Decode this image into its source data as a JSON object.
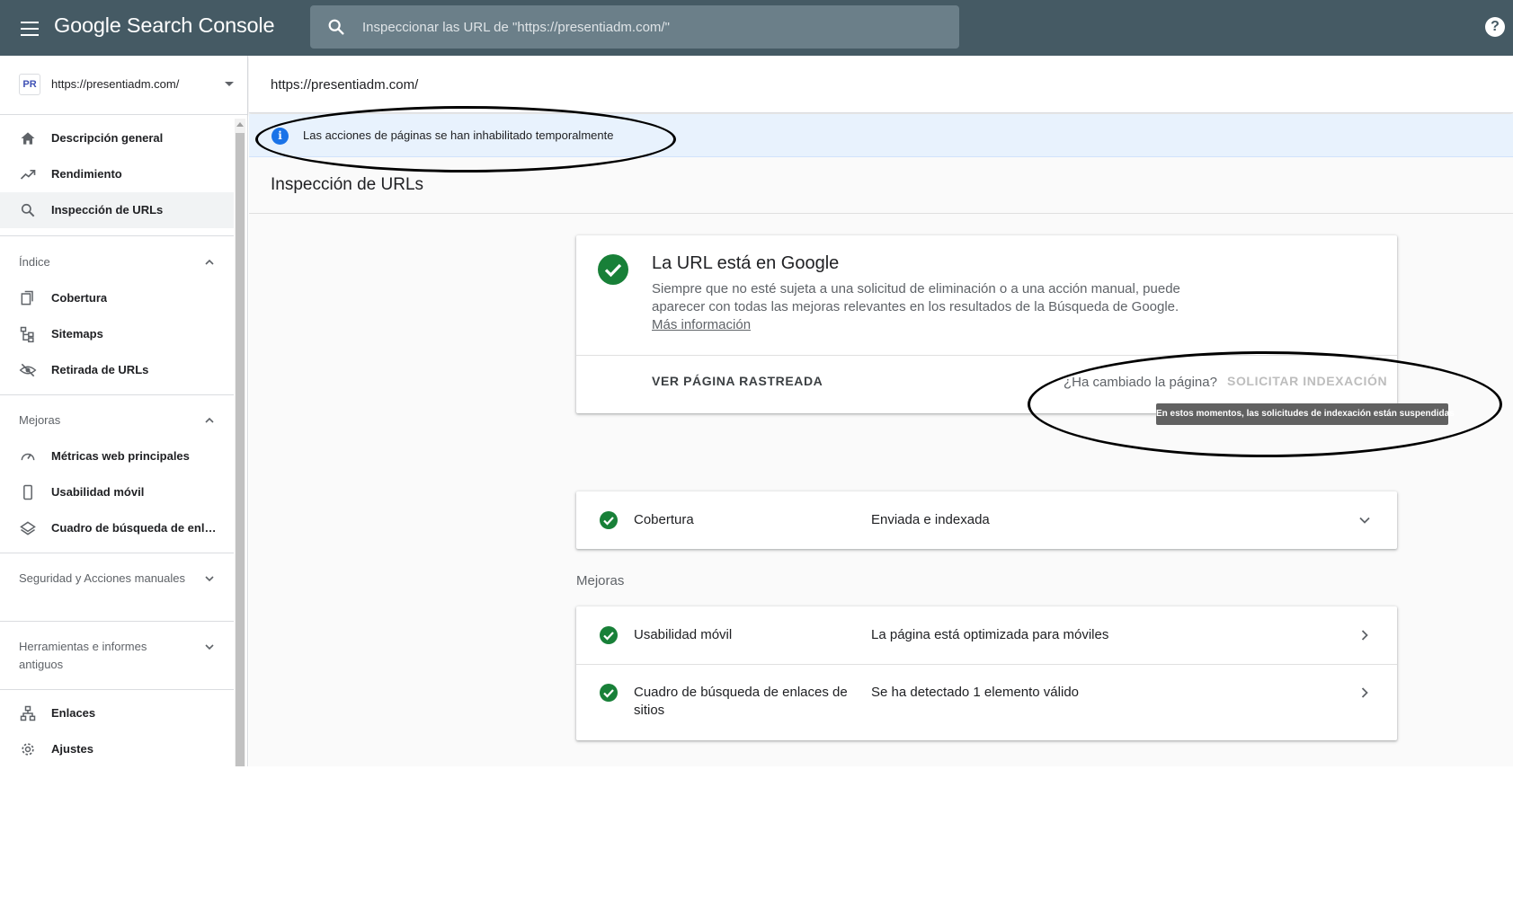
{
  "header": {
    "logo": "Google Search Console",
    "search_placeholder": "Inspeccionar las URL de \"https://presentiadm.com/\""
  },
  "property": {
    "badge": "PR",
    "url": "https://presentiadm.com/"
  },
  "nav": {
    "overview": "Descripción general",
    "performance": "Rendimiento",
    "url_inspection": "Inspección de URLs",
    "index_section": "Índice",
    "coverage": "Cobertura",
    "sitemaps": "Sitemaps",
    "removals": "Retirada de URLs",
    "enhancements_section": "Mejoras",
    "core_web_vitals": "Métricas web principales",
    "mobile_usability": "Usabilidad móvil",
    "sitelinks_searchbox": "Cuadro de búsqueda de enla…",
    "security_section": "Seguridad y Acciones manuales",
    "legacy_section": "Herramientas e informes antiguos",
    "links": "Enlaces",
    "settings": "Ajustes"
  },
  "main": {
    "inspected_url": "https://presentiadm.com/",
    "banner": "Las acciones de páginas se han inhabilitado temporalmente",
    "page_title": "Inspección de URLs",
    "status": {
      "title": "La URL está en Google",
      "description": "Siempre que no esté sujeta a una solicitud de eliminación o a una acción manual, puede aparecer con todas las mejoras relevantes en los resultados de la Búsqueda de Google.",
      "learn_more": "Más información",
      "view_crawled": "VER PÁGINA RASTREADA",
      "changed_question": "¿Ha cambiado la página?",
      "request_indexing": "SOLICITAR INDEXACIÓN",
      "tooltip": "En estos momentos, las solicitudes de indexación están suspendidas"
    },
    "coverage": {
      "label": "Cobertura",
      "value": "Enviada e indexada"
    },
    "enhancements": {
      "title": "Mejoras",
      "mobile_label": "Usabilidad móvil",
      "mobile_value": "La página está optimizada para móviles",
      "sitelinks_label": "Cuadro de búsqueda de enlaces de sitios",
      "sitelinks_value": "Se ha detectado 1 elemento válido"
    }
  },
  "colors": {
    "header_bg": "#455a64",
    "success_green": "#188038",
    "info_blue": "#1a73e8",
    "banner_bg": "#e8f2fd"
  }
}
